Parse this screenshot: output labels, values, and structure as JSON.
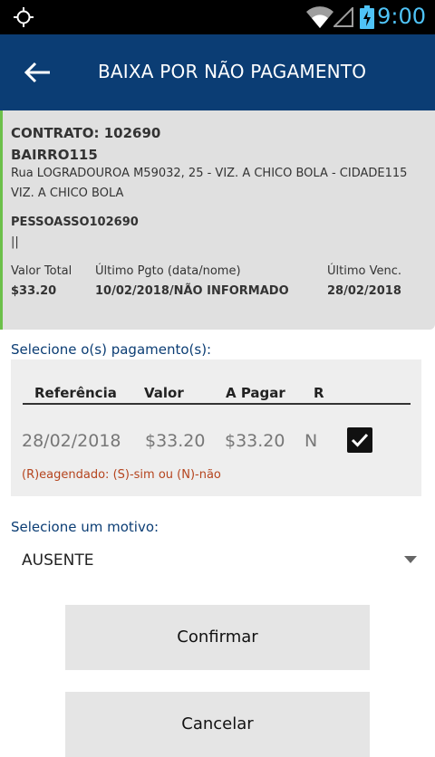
{
  "status_bar": {
    "time": "9:00",
    "icons": [
      "gps-icon",
      "wifi-icon",
      "signal-icon",
      "battery-charging-icon"
    ],
    "accent": "#4fc3f7"
  },
  "app_bar": {
    "title": "BAIXA POR NÃO PAGAMENTO",
    "back_icon": "arrow-back-icon",
    "background": "#0b3d74"
  },
  "contract": {
    "contract_line": "CONTRATO: 102690",
    "district": "BAIRRO115",
    "address_line1": "Rua LOGRADOUROA M59032, 25 - VIZ. A CHICO BOLA - CIDADE115",
    "address_line2": "VIZ. A CHICO BOLA",
    "person": "PESSOASSO102690",
    "phone": "||",
    "total_label": "Valor Total",
    "total_value": "$33.20",
    "last_payment_label": "Último Pgto (data/nome)",
    "last_payment_value": "10/02/2018/NÃO INFORMADO",
    "last_due_label": "Último Venc.",
    "last_due_value": "28/02/2018",
    "accent": "#6cc04a"
  },
  "payments": {
    "section_label": "Selecione o(s) pagamento(s):",
    "headers": [
      "Referência",
      "Valor",
      "A Pagar",
      "R"
    ],
    "rows": [
      {
        "reference": "28/02/2018",
        "value": "$33.20",
        "to_pay": "$33.20",
        "rescheduled": "N",
        "checked": true
      }
    ],
    "legend": "(R)eagendado: (S)-sim ou (N)-não"
  },
  "reason": {
    "section_label": "Selecione um motivo:",
    "selected": "AUSENTE"
  },
  "actions": {
    "confirm_label": "Confirmar",
    "cancel_label": "Cancelar"
  }
}
